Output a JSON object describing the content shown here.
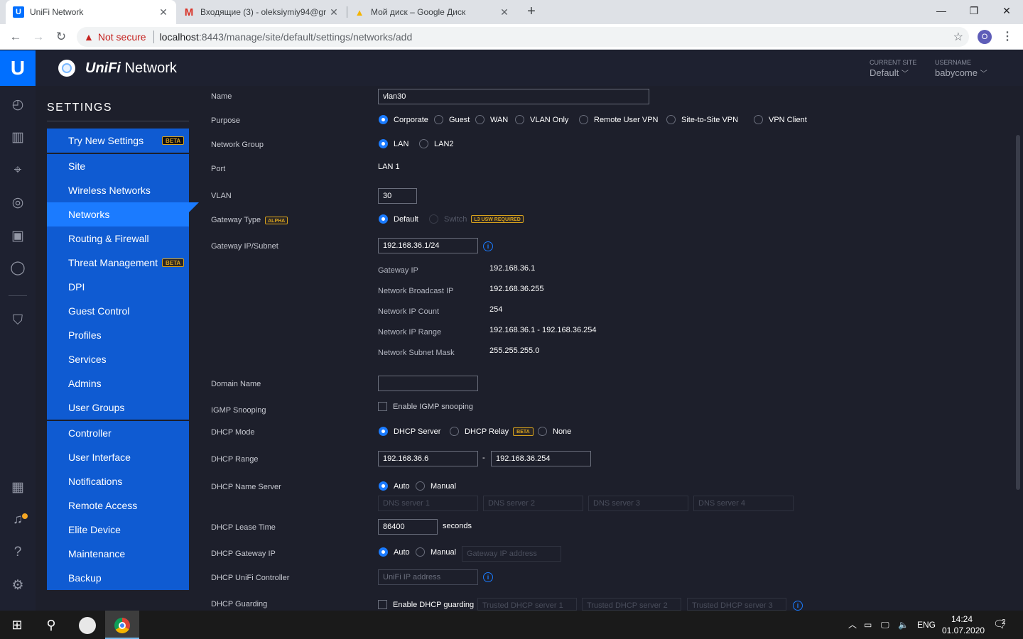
{
  "browser": {
    "tabs": [
      {
        "title": "UniFi Network",
        "favicon": "U",
        "active": true
      },
      {
        "title": "Входящие (3) - oleksiymiy94@gr",
        "favicon": "M"
      },
      {
        "title": "Мой диск – Google Диск",
        "favicon": "▲"
      }
    ],
    "new_tab": "+",
    "security_label": "Not secure",
    "url_host": "localhost",
    "url_path": ":8443/manage/site/default/settings/networks/add",
    "profile_initial": "O"
  },
  "header": {
    "app_brand": "UniFi",
    "app_name": " Network",
    "current_site_caption": "CURRENT SITE",
    "current_site": "Default",
    "username_caption": "USERNAME",
    "username": "babycome"
  },
  "settings": {
    "title": "SETTINGS",
    "try_new": "Try New Settings",
    "beta": "BETA",
    "group1": [
      "Site",
      "Wireless Networks",
      "Networks",
      "Routing & Firewall",
      "Threat Management",
      "DPI",
      "Guest Control",
      "Profiles",
      "Services",
      "Admins",
      "User Groups"
    ],
    "group2": [
      "Controller",
      "User Interface",
      "Notifications",
      "Remote Access",
      "Elite Device",
      "Maintenance",
      "Backup"
    ]
  },
  "form": {
    "name_label": "Name",
    "name_value": "vlan30",
    "purpose_label": "Purpose",
    "purpose_options": [
      "Corporate",
      "Guest",
      "WAN",
      "VLAN Only",
      "Remote User VPN",
      "Site-to-Site VPN",
      "VPN Client"
    ],
    "network_group_label": "Network Group",
    "network_group_options": [
      "LAN",
      "LAN2"
    ],
    "port_label": "Port",
    "port_value": "LAN 1",
    "vlan_label": "VLAN",
    "vlan_value": "30",
    "gateway_type_label": "Gateway Type",
    "alpha_badge": "ALPHA",
    "gateway_type_options": [
      "Default",
      "Switch"
    ],
    "l3_badge": "L3 USW REQUIRED",
    "gateway_subnet_label": "Gateway IP/Subnet",
    "gateway_subnet_value": "192.168.36.1/24",
    "info_glyph": "i",
    "details": [
      {
        "label": "Gateway IP",
        "value": "192.168.36.1"
      },
      {
        "label": "Network Broadcast IP",
        "value": "192.168.36.255"
      },
      {
        "label": "Network IP Count",
        "value": "254"
      },
      {
        "label": "Network IP Range",
        "value": "192.168.36.1 - 192.168.36.254"
      },
      {
        "label": "Network Subnet Mask",
        "value": "255.255.255.0"
      }
    ],
    "domain_label": "Domain Name",
    "igmp_label": "IGMP Snooping",
    "igmp_check": "Enable IGMP snooping",
    "dhcp_mode_label": "DHCP Mode",
    "dhcp_mode_options": [
      "DHCP Server",
      "DHCP Relay",
      "None"
    ],
    "dhcp_range_label": "DHCP Range",
    "dhcp_range_start": "192.168.36.6",
    "dhcp_range_dash": "-",
    "dhcp_range_end": "192.168.36.254",
    "dhcp_ns_label": "DHCP Name Server",
    "dhcp_ns_options": [
      "Auto",
      "Manual"
    ],
    "dns_placeholders": [
      "DNS server 1",
      "DNS server 2",
      "DNS server 3",
      "DNS server 4"
    ],
    "lease_label": "DHCP Lease Time",
    "lease_value": "86400",
    "lease_unit": "seconds",
    "gw_ip_label": "DHCP Gateway IP",
    "gw_ip_options": [
      "Auto",
      "Manual"
    ],
    "gw_ip_placeholder": "Gateway IP address",
    "unifi_ctrl_label": "DHCP UniFi Controller",
    "unifi_ctrl_placeholder": "UniFi IP address",
    "guarding_label": "DHCP Guarding",
    "guarding_check": "Enable DHCP guarding",
    "trusted_placeholders": [
      "Trusted DHCP server 1",
      "Trusted DHCP server 2",
      "Trusted DHCP server 3"
    ]
  },
  "taskbar": {
    "lang": "ENG",
    "time": "14:24",
    "date": "01.07.2020",
    "notif_count": "2"
  }
}
